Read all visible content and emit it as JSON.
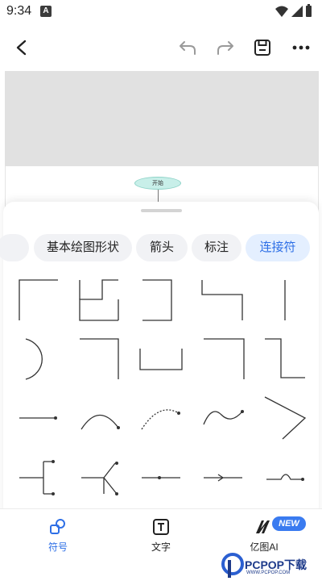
{
  "status_bar": {
    "time": "9:34",
    "app_icon_letter": "A"
  },
  "toolbar": {
    "back": "back-arrow-icon",
    "undo": "undo-icon",
    "redo": "redo-icon",
    "save": "save-icon",
    "more": "more-icon"
  },
  "canvas": {
    "start_node_label": "开始"
  },
  "categories": [
    {
      "label": ""
    },
    {
      "label": "基本绘图形状"
    },
    {
      "label": "箭头"
    },
    {
      "label": "标注"
    },
    {
      "label": "连接符",
      "active": true
    }
  ],
  "bottom_nav": {
    "symbols_label": "符号",
    "text_label": "文字",
    "ai_label": "亿图AI",
    "ai_badge": "NEW"
  },
  "watermark": {
    "text": "PCPOP下载",
    "sub": "WWW.PCPOP.COM"
  },
  "colors": {
    "accent": "#2e6fe6",
    "chip_bg": "#f1f2f5",
    "chip_active_bg": "#e4efff",
    "canvas_gray": "#e1e1e1",
    "start_node": "#c8efe9"
  }
}
